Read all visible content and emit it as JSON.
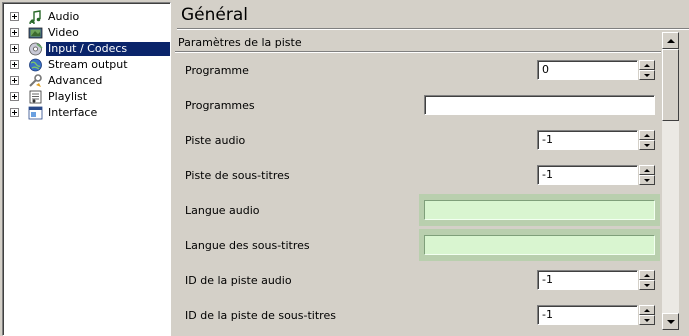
{
  "tree": {
    "items": [
      {
        "label": "Audio",
        "icon": "audio-icon"
      },
      {
        "label": "Video",
        "icon": "video-icon"
      },
      {
        "label": "Input / Codecs",
        "icon": "input-codecs-icon",
        "selected": true
      },
      {
        "label": "Stream output",
        "icon": "stream-output-icon"
      },
      {
        "label": "Advanced",
        "icon": "advanced-icon"
      },
      {
        "label": "Playlist",
        "icon": "playlist-icon"
      },
      {
        "label": "Interface",
        "icon": "interface-icon"
      }
    ]
  },
  "panel": {
    "title": "Général",
    "section": "Paramètres de la piste",
    "rows": [
      {
        "label": "Programme",
        "type": "spin",
        "value": "0"
      },
      {
        "label": "Programmes",
        "type": "text",
        "value": ""
      },
      {
        "label": "Piste audio",
        "type": "spin",
        "value": "-1"
      },
      {
        "label": "Piste de sous-titres",
        "type": "spin",
        "value": "-1"
      },
      {
        "label": "Langue audio",
        "type": "highlight",
        "value": ""
      },
      {
        "label": "Langue des sous-titres",
        "type": "highlight",
        "value": ""
      },
      {
        "label": "ID de la piste audio",
        "type": "spin",
        "value": "-1"
      },
      {
        "label": "ID de la piste de sous-titres",
        "type": "spin",
        "value": "-1"
      }
    ]
  },
  "colors": {
    "selection": "#0a246a",
    "window": "#d4d0c8",
    "highlight_bg": "#b9cfae",
    "highlight_field": "#d9f5d0"
  }
}
